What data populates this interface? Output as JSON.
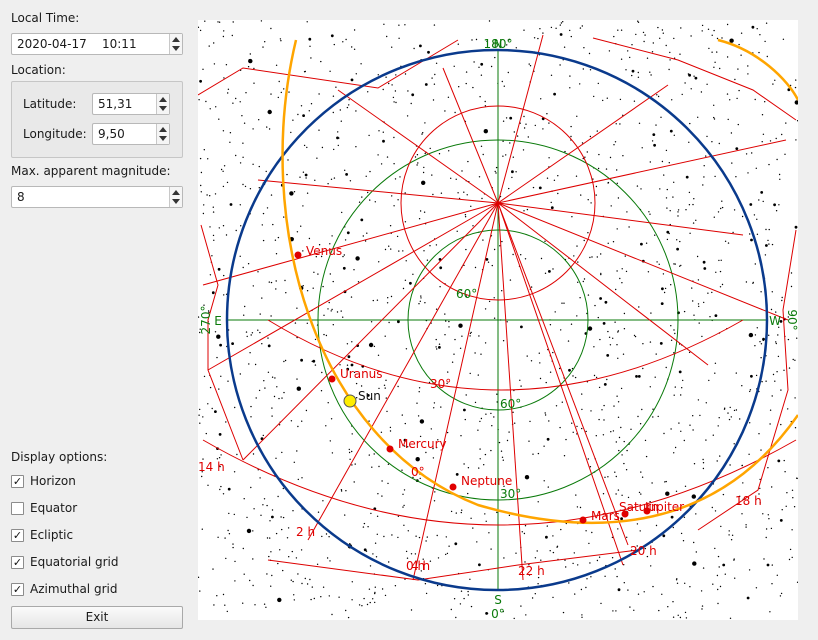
{
  "panel": {
    "local_time_label": "Local Time:",
    "local_time_value": "2020-04-17    10:11",
    "location_label": "Location:",
    "latitude_label": "Latitude:",
    "latitude_value": "51,31",
    "longitude_label": "Longitude:",
    "longitude_value": "9,50",
    "magnitude_label": "Max. apparent magnitude:",
    "magnitude_value": "8",
    "display_options_label": "Display options:",
    "options": [
      {
        "label": "Horizon",
        "checked": true
      },
      {
        "label": "Equator",
        "checked": false
      },
      {
        "label": "Ecliptic",
        "checked": true
      },
      {
        "label": "Equatorial grid",
        "checked": true
      },
      {
        "label": "Azimuthal grid",
        "checked": true
      }
    ],
    "exit_label": "Exit"
  },
  "sky": {
    "colors": {
      "horizon": "#0a3a8c",
      "ecliptic": "#ffa500",
      "equatorial_grid": "#dd0000",
      "azimuthal_grid": "#0a7a0a",
      "planet": "#e00000",
      "sun": "#ffee00",
      "stars": "#000000"
    },
    "cardinal": {
      "north": "N",
      "south": "S",
      "east": "E",
      "west": "W"
    },
    "azimuth_labels": {
      "north": "180°",
      "south": "0°",
      "east": "270°",
      "west": "90°"
    },
    "altitude_labels": [
      "30°",
      "60°"
    ],
    "declination_labels": [
      "30°",
      "60°",
      "0°"
    ],
    "hour_labels": [
      "14 h",
      "18 h",
      "2 h",
      "20 h",
      "22 h",
      "0 h",
      "4 h"
    ],
    "planets": [
      {
        "name": "Venus"
      },
      {
        "name": "Uranus"
      },
      {
        "name": "Mercury"
      },
      {
        "name": "Neptune"
      },
      {
        "name": "Mars"
      },
      {
        "name": "Saturn"
      },
      {
        "name": "Jupiter"
      }
    ],
    "sun_label": "Sun"
  }
}
